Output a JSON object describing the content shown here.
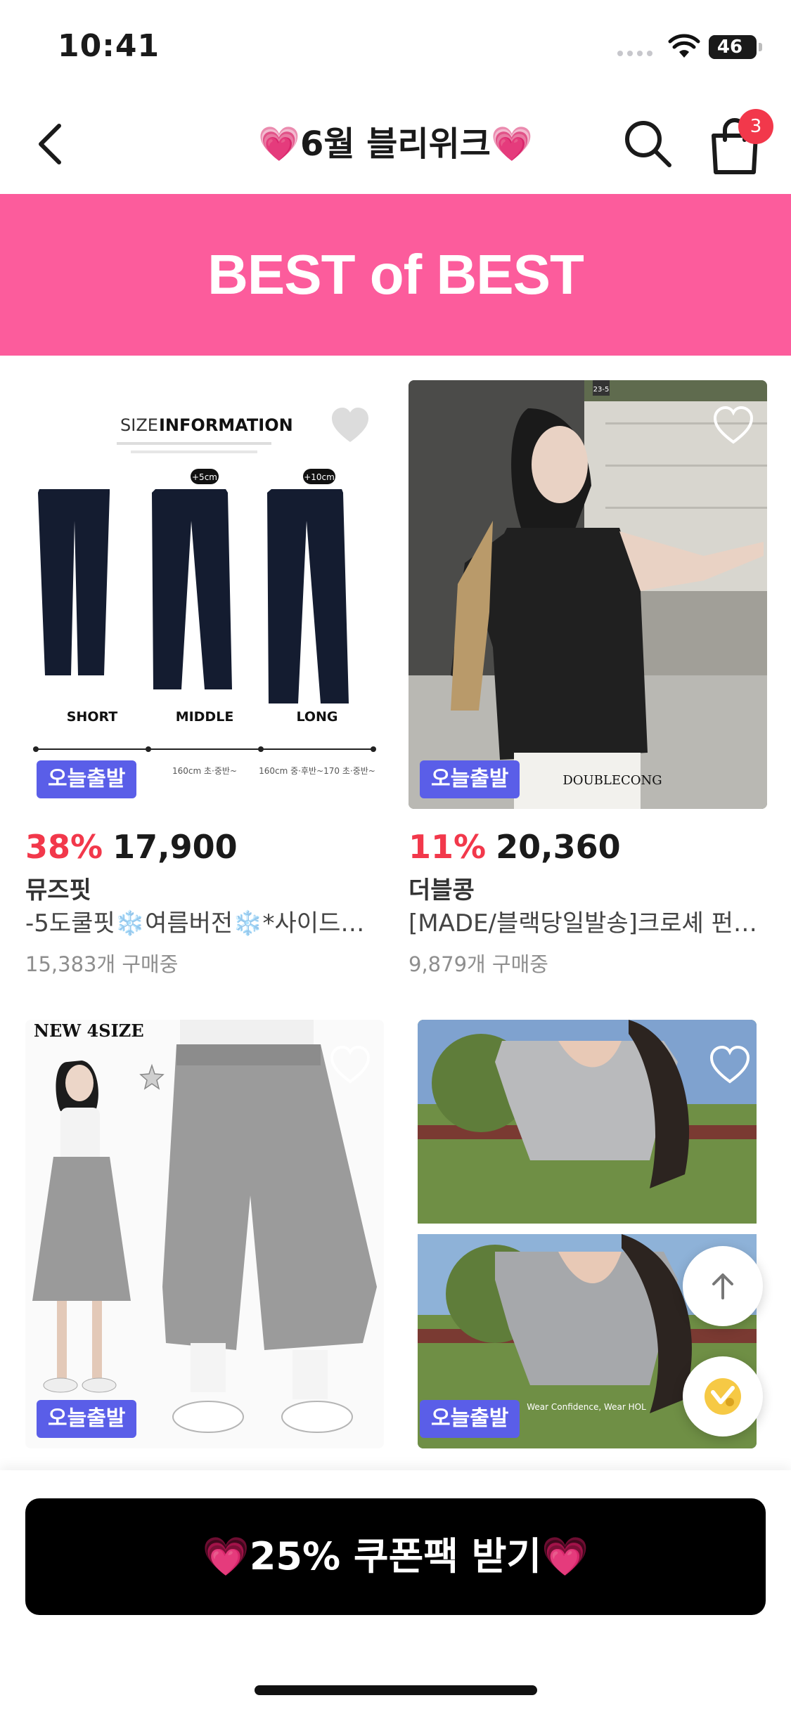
{
  "status_bar": {
    "time": "10:41",
    "battery": "46",
    "battery_level": 0.46
  },
  "nav": {
    "title": "💗6월 블리위크💗",
    "cart_count": "3",
    "icons": {
      "back": "chevron-left-icon",
      "search": "search-icon",
      "cart": "shopping-bag-icon"
    }
  },
  "banner": {
    "text": "BEST of BEST",
    "color": "#fc5c9c"
  },
  "colors": {
    "discount": "#f2384b",
    "badge": "#5a5ee8",
    "cta_bg": "#000000"
  },
  "products": [
    {
      "discount": "38%",
      "price": "17,900",
      "brand": "뮤즈핏",
      "name": "-5도쿨핏❄️여름버전❄️*사이드…",
      "sold": "15,383개 구매중",
      "badge": "오늘출발",
      "image_text": {
        "heading_light": "SIZE",
        "heading_bold": "INFORMATION",
        "size_short": "SHORT",
        "size_middle": "MIDDLE",
        "size_long": "LONG",
        "tag_middle": "+5cm",
        "tag_long": "+10cm",
        "caption_middle": "160cm 초·중반~",
        "caption_long": "160cm 중·후반~170 초·중반~"
      }
    },
    {
      "discount": "11%",
      "price": "20,360",
      "brand": "더블콩",
      "name": "[MADE/블랙당일발송]크로셰 펀칭…",
      "sold": "9,879개 구매중",
      "badge": "오늘출발",
      "image_text": {
        "watermark": "DOUBLECONG",
        "wall_number": "23-5"
      }
    },
    {
      "badge": "오늘출발",
      "image_text": {
        "tag": "NEW 4SIZE"
      }
    },
    {
      "badge": "오늘출발",
      "image_text": {
        "watermark": "Wear Confidence, Wear HOL"
      }
    }
  ],
  "floating": {
    "scroll_top": "arrow-up-icon",
    "assistant": "assistant-icon"
  },
  "cta": {
    "label": "💗25% 쿠폰팩 받기💗"
  }
}
